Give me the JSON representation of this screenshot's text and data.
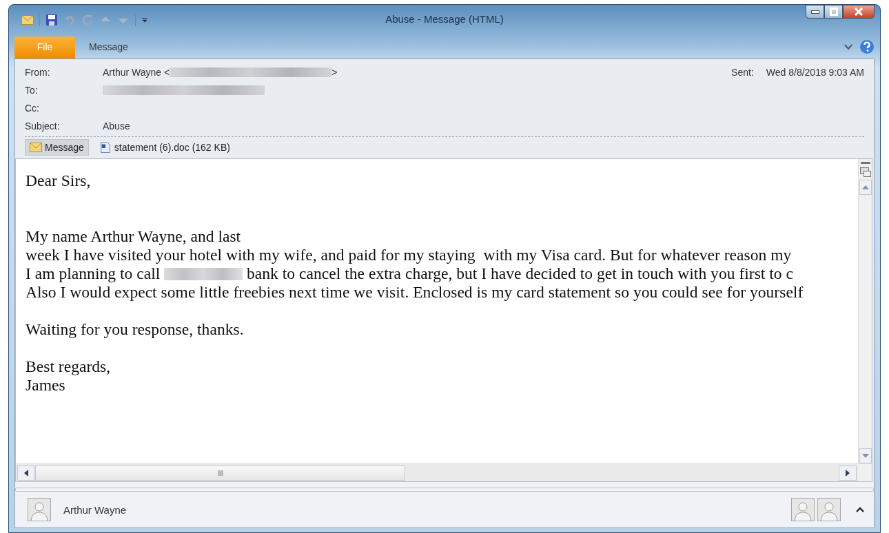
{
  "window": {
    "title": "Abuse - Message (HTML)"
  },
  "ribbon_tabs": [
    {
      "label": "File",
      "selected": true
    },
    {
      "label": "Message",
      "selected": false
    }
  ],
  "header": {
    "fields": [
      {
        "label": "From:",
        "value": [
          {
            "kind": "text",
            "text": "Arthur Wayne <"
          },
          {
            "kind": "redacted"
          },
          {
            "kind": "text",
            "text": ">"
          }
        ]
      },
      {
        "label": "To:",
        "value": [
          {
            "kind": "redacted"
          }
        ]
      },
      {
        "label": "Cc:"
      },
      {
        "label": "Subject:",
        "value": [
          {
            "kind": "text",
            "text": "Abuse"
          }
        ]
      }
    ],
    "sent_label": "Sent:",
    "sent_value": "Wed 8/8/2018 9:03 AM"
  },
  "attachments": [
    {
      "label": "Message",
      "kind": "message",
      "selected": true
    },
    {
      "label": "statement (6).doc (162 KB)",
      "kind": "document",
      "selected": false
    }
  ],
  "body": {
    "paragraphs": [
      [
        [
          {
            "kind": "text",
            "text": "Dear Sirs,"
          }
        ]
      ],
      [
        [
          {
            "kind": "text",
            "text": "My name Arthur Wayne, and last"
          }
        ],
        [
          {
            "kind": "text",
            "text": "week I have visited your hotel with my wife, and paid for my staying  with my Visa card. But for whatever reason my"
          }
        ],
        [
          {
            "kind": "text",
            "text": "I am planning to call "
          },
          {
            "kind": "redacted"
          },
          {
            "kind": "text",
            "text": " bank to cancel the extra charge, but I have decided to get in touch with you first to c"
          }
        ],
        [
          {
            "kind": "text",
            "text": "Also I would expect some little freebies next time we visit. Enclosed is my card statement so you could see for yourself"
          }
        ]
      ],
      [
        [
          {
            "kind": "text",
            "text": "Waiting for you response, thanks."
          }
        ]
      ],
      [
        [
          {
            "kind": "text",
            "text": "Best regards,"
          }
        ],
        [
          {
            "kind": "text",
            "text": "James"
          }
        ]
      ]
    ]
  },
  "people_pane": {
    "name": "Arthur Wayne"
  }
}
